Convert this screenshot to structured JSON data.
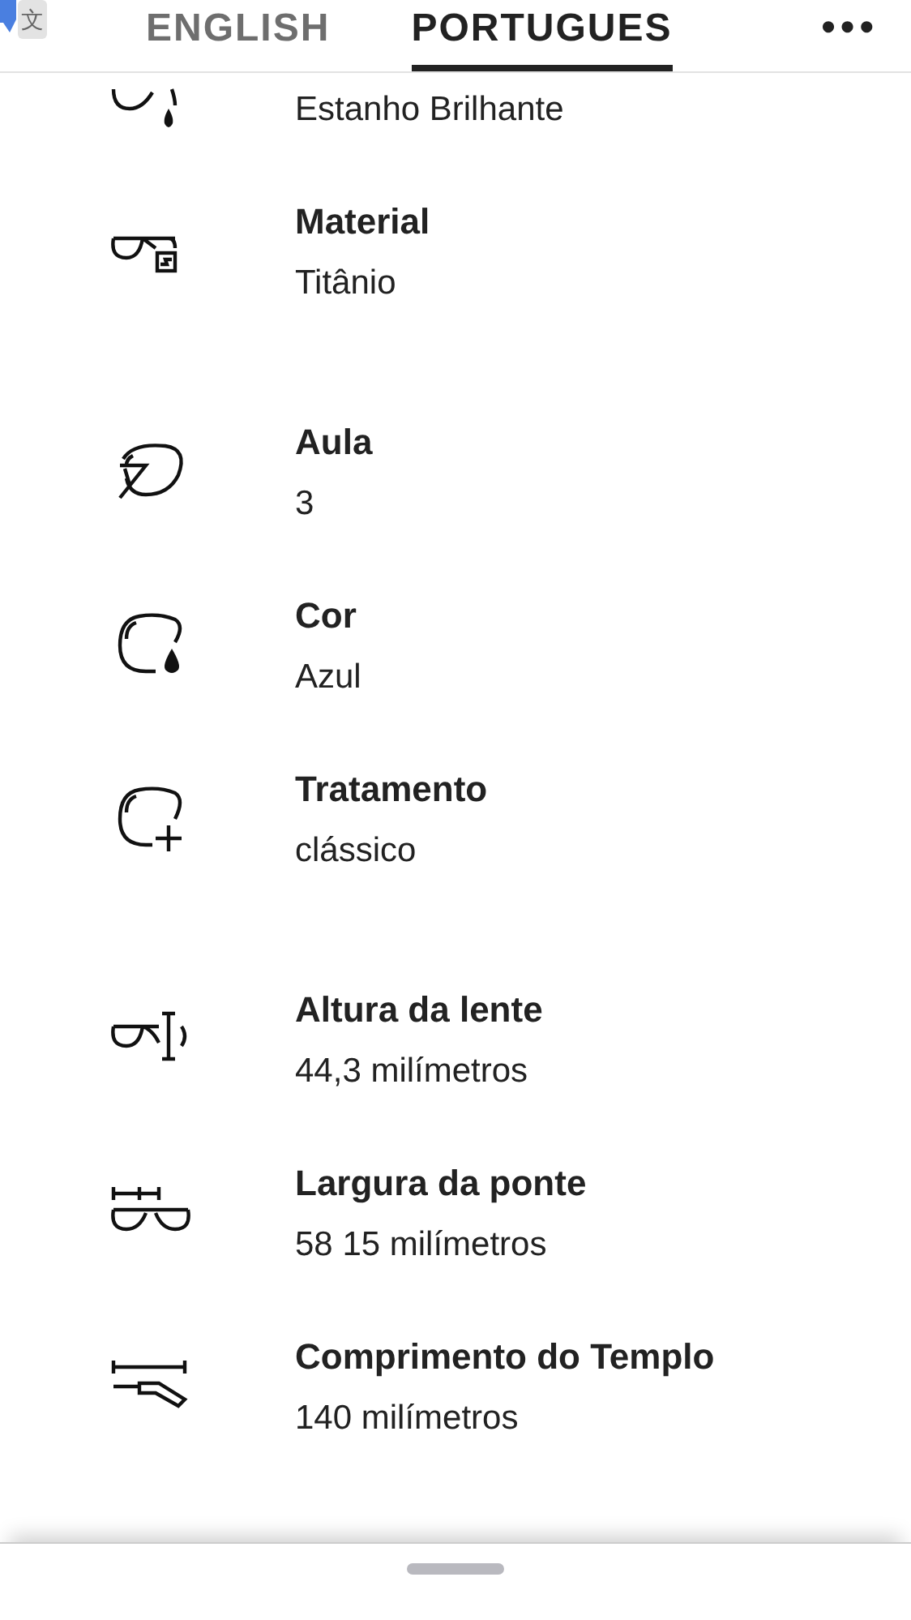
{
  "header": {
    "translate_glyph": "文",
    "tabs": [
      {
        "label": "ENGLISH",
        "selected": false
      },
      {
        "label": "PORTUGUES",
        "selected": true
      }
    ],
    "more": "•••"
  },
  "groups": [
    {
      "items": [
        {
          "kind": "frame-color",
          "value": "Estanho Brilhante"
        },
        {
          "kind": "material",
          "label": "Material",
          "value": "Titânio"
        }
      ]
    },
    {
      "items": [
        {
          "kind": "lens-class",
          "label": "Aula",
          "value": "3"
        },
        {
          "kind": "lens-color",
          "label": "Cor",
          "value": "Azul"
        },
        {
          "kind": "lens-treatment",
          "label": "Tratamento",
          "value": "clássico"
        }
      ]
    },
    {
      "items": [
        {
          "kind": "lens-height",
          "label": "Altura da lente",
          "value": "44,3 milímetros"
        },
        {
          "kind": "bridge-width",
          "label": "Largura da ponte",
          "value": "58 15 milímetros"
        },
        {
          "kind": "temple-length",
          "label": "Comprimento do Templo",
          "value": "140 milímetros"
        }
      ]
    }
  ]
}
